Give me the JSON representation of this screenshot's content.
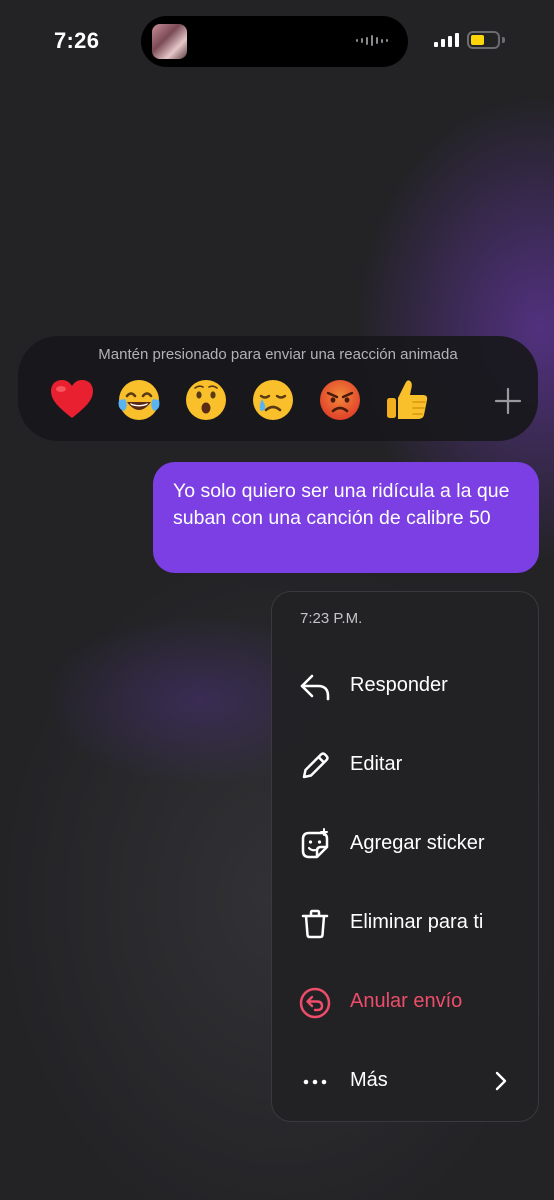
{
  "status_bar": {
    "time": "7:26"
  },
  "reaction_bar": {
    "hint": "Mantén presionado para enviar una reacción animada",
    "emojis": [
      "❤️",
      "😂",
      "😮",
      "😢",
      "😡",
      "👍"
    ],
    "more_icon": "plus-icon"
  },
  "message": {
    "text": "Yo solo quiero ser una ridícula a la que suban con una canción de calibre 50",
    "bubble_color": "#7b3fe4"
  },
  "context_menu": {
    "timestamp": "7:23 P.M.",
    "items": [
      {
        "label": "Responder",
        "icon": "reply-icon"
      },
      {
        "label": "Editar",
        "icon": "pencil-icon"
      },
      {
        "label": "Agregar sticker",
        "icon": "sticker-icon"
      },
      {
        "label": "Eliminar para ti",
        "icon": "trash-icon"
      },
      {
        "label": "Anular envío",
        "icon": "unsend-icon",
        "color": "#ed4d6a"
      },
      {
        "label": "Más",
        "icon": "more-dots-icon"
      }
    ]
  }
}
